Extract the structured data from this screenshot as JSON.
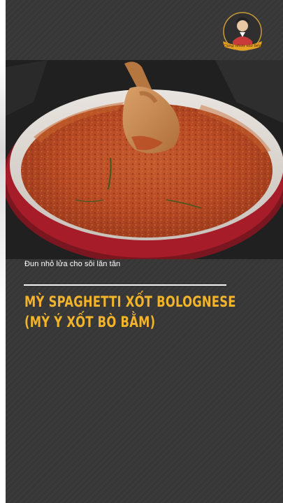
{
  "video": {
    "caption": "Đun nhỏ lửa cho sôi lăn tăn",
    "title_line1": "MỲ SPAGHETTI XỐT BOLOGNESE",
    "title_line2": "(MỲ Ý XỐT BÒ BẰM)"
  },
  "logo": {
    "text": "Cùng nhau vào bếp",
    "icon": "chef-avatar-icon"
  },
  "colors": {
    "title": "#f3b32a",
    "caption": "#ffffff",
    "background": "#383838",
    "sauce": "#c4542a",
    "pan_rim": "#b3202a"
  }
}
